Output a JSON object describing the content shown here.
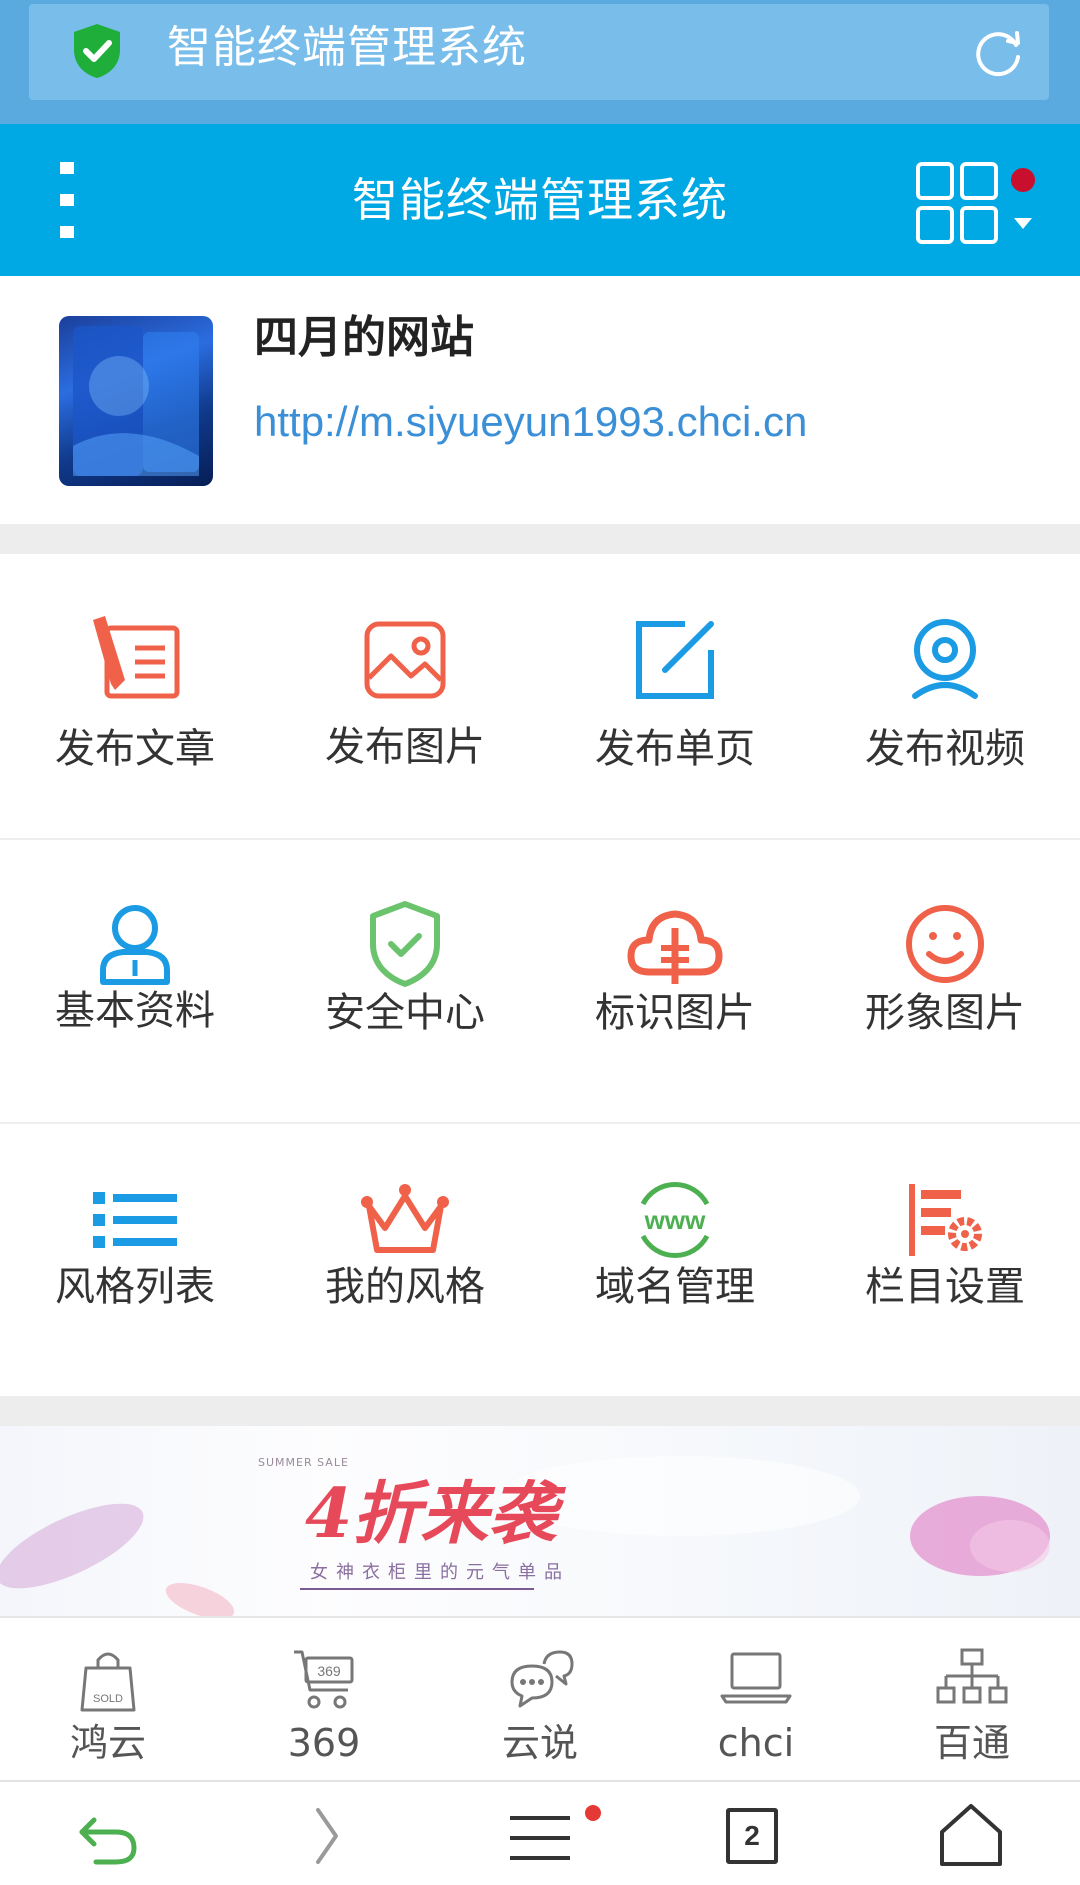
{
  "browser": {
    "address_title": "智能终端管理系统",
    "tab_count": "2"
  },
  "header": {
    "title": "智能终端管理系统"
  },
  "site": {
    "name": "四月的网站",
    "url": "http://m.siyueyun1993.chci.cn"
  },
  "grid": {
    "items": [
      {
        "label": "发布文章",
        "icon": "publish-article-icon"
      },
      {
        "label": "发布图片",
        "icon": "publish-image-icon"
      },
      {
        "label": "发布单页",
        "icon": "publish-page-icon"
      },
      {
        "label": "发布视频",
        "icon": "publish-video-icon"
      },
      {
        "label": "基本资料",
        "icon": "profile-icon"
      },
      {
        "label": "安全中心",
        "icon": "security-shield-icon"
      },
      {
        "label": "标识图片",
        "icon": "logo-cloud-icon"
      },
      {
        "label": "形象图片",
        "icon": "smiley-icon"
      },
      {
        "label": "风格列表",
        "icon": "style-list-icon"
      },
      {
        "label": "我的风格",
        "icon": "crown-icon"
      },
      {
        "label": "域名管理",
        "icon": "www-domain-icon"
      },
      {
        "label": "栏目设置",
        "icon": "column-settings-icon"
      }
    ]
  },
  "banner": {
    "small": "SUMMER SALE",
    "title": "4折来袭",
    "subtitle": "女神衣柜里的元气单品"
  },
  "bottom_nav": {
    "items": [
      {
        "label": "鸿云",
        "icon": "shopping-bag-icon"
      },
      {
        "label": "369",
        "icon": "cart-icon"
      },
      {
        "label": "云说",
        "icon": "chat-bubbles-icon"
      },
      {
        "label": "chci",
        "icon": "laptop-icon"
      },
      {
        "label": "百通",
        "icon": "org-chart-icon"
      }
    ]
  },
  "colors": {
    "header_blue": "#00a9e4",
    "browser_blue": "#5aa9df",
    "accent_red": "#f0614a",
    "accent_blue": "#1a9be4",
    "accent_green": "#4caf50"
  }
}
